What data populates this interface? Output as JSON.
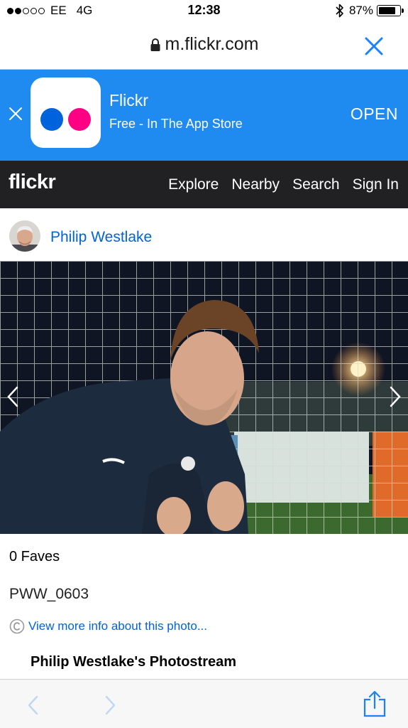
{
  "status_bar": {
    "carrier": "EE",
    "network": "4G",
    "time": "12:38",
    "battery": "87%",
    "battery_level": 0.87,
    "signal_bars": 2,
    "signal_total": 5
  },
  "browser": {
    "url": "m.flickr.com"
  },
  "app_banner": {
    "app_name": "Flickr",
    "subtitle": "Free - In The App Store",
    "open_label": "OPEN",
    "color": "#1f8bf0"
  },
  "nav": {
    "logo": "flickr",
    "links": [
      "Explore",
      "Nearby",
      "Search",
      "Sign In"
    ]
  },
  "author": {
    "name": "Philip Westlake"
  },
  "photo": {
    "faves": "0 Faves",
    "title": "PWW_0603",
    "info_link": "View more info about this photo...",
    "photostream": "Philip Westlake's Photostream"
  },
  "colors": {
    "link_blue": "#0063dc",
    "flickr_pink": "#ff0084",
    "ios_blue": "#1a82fb"
  }
}
